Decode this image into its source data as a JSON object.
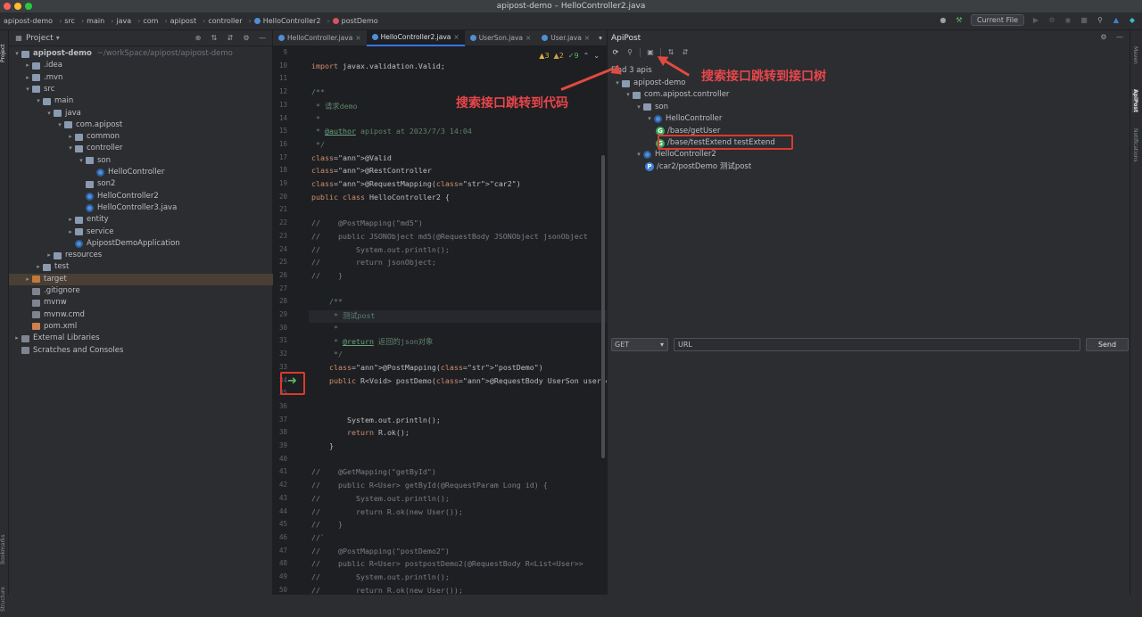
{
  "window": {
    "title": "apipost-demo – HelloController2.java"
  },
  "breadcrumbs": [
    "apipost-demo",
    "src",
    "main",
    "java",
    "com",
    "apipost",
    "controller",
    "HelloController2",
    "postDemo"
  ],
  "toolbar": {
    "run_config": "Current File"
  },
  "project_panel": {
    "title": "Project",
    "tree": [
      {
        "label": "apipost-demo",
        "extra": "~/workSpace/apipost/apipost-demo",
        "icon": "module-icon",
        "expanded": true
      },
      {
        "label": ".idea",
        "icon": "folder-icon"
      },
      {
        "label": ".mvn",
        "icon": "folder-icon"
      },
      {
        "label": "src",
        "icon": "folder-icon",
        "expanded": true
      },
      {
        "label": "main",
        "icon": "folder-icon",
        "expanded": true
      },
      {
        "label": "java",
        "icon": "folder-icon",
        "expanded": true
      },
      {
        "label": "com.apipost",
        "icon": "package-icon",
        "expanded": true
      },
      {
        "label": "common",
        "icon": "package-icon"
      },
      {
        "label": "controller",
        "icon": "package-icon",
        "expanded": true
      },
      {
        "label": "son",
        "icon": "package-icon",
        "expanded": true
      },
      {
        "label": "HelloController",
        "icon": "class-icon"
      },
      {
        "label": "son2",
        "icon": "package-icon"
      },
      {
        "label": "HelloController2",
        "icon": "class-icon"
      },
      {
        "label": "HelloController3.java",
        "icon": "java-file-icon"
      },
      {
        "label": "entity",
        "icon": "package-icon"
      },
      {
        "label": "service",
        "icon": "package-icon"
      },
      {
        "label": "ApipostDemoApplication",
        "icon": "class-icon"
      },
      {
        "label": "resources",
        "icon": "folder-icon"
      },
      {
        "label": "test",
        "icon": "folder-icon"
      },
      {
        "label": "target",
        "icon": "folder-icon",
        "selected": true
      },
      {
        "label": ".gitignore",
        "icon": "file-icon"
      },
      {
        "label": "mvnw",
        "icon": "file-icon"
      },
      {
        "label": "mvnw.cmd",
        "icon": "file-icon"
      },
      {
        "label": "pom.xml",
        "icon": "maven-icon"
      },
      {
        "label": "External Libraries",
        "icon": "library-icon"
      },
      {
        "label": "Scratches and Consoles",
        "icon": "scratch-icon"
      }
    ]
  },
  "editor": {
    "tabs": [
      {
        "label": "HelloController.java"
      },
      {
        "label": "HelloController2.java",
        "active": true
      },
      {
        "label": "UserSon.java"
      },
      {
        "label": "User.java"
      }
    ],
    "inspections": {
      "warnings": "3",
      "weak": "2",
      "typos": "9"
    },
    "lines": [
      {
        "n": "9",
        "text": ""
      },
      {
        "n": "10",
        "text": "import javax.validation.Valid;"
      },
      {
        "n": "11",
        "text": ""
      },
      {
        "n": "12",
        "text": "/**"
      },
      {
        "n": "13",
        "text": " * 请求demo"
      },
      {
        "n": "14",
        "text": " *"
      },
      {
        "n": "15",
        "text": " * @author apipost at 2023/7/3 14:04"
      },
      {
        "n": "16",
        "text": " */"
      },
      {
        "n": "17",
        "text": "@Valid"
      },
      {
        "n": "18",
        "text": "@RestController"
      },
      {
        "n": "19",
        "text": "@RequestMapping(\"car2\")"
      },
      {
        "n": "20",
        "text": "public class HelloController2 {"
      },
      {
        "n": "21",
        "text": ""
      },
      {
        "n": "22",
        "text": "//    @PostMapping(\"md5\")"
      },
      {
        "n": "23",
        "text": "//    public JSONObject md5(@RequestBody JSONObject jsonObject"
      },
      {
        "n": "24",
        "text": "//        System.out.println();"
      },
      {
        "n": "25",
        "text": "//        return jsonObject;"
      },
      {
        "n": "26",
        "text": "//    }"
      },
      {
        "n": "27",
        "text": ""
      },
      {
        "n": "28",
        "text": "    /**"
      },
      {
        "n": "29",
        "text": "     * 测试post"
      },
      {
        "n": "30",
        "text": "     *"
      },
      {
        "n": "31",
        "text": "     * @return 返回的json对象"
      },
      {
        "n": "32",
        "text": "     */"
      },
      {
        "n": "33",
        "text": "    @PostMapping(\"postDemo\")"
      },
      {
        "n": "34",
        "text": "    public R<Void> postDemo(@RequestBody UserSon userSon) {"
      },
      {
        "n": "35",
        "text": ""
      },
      {
        "n": "36",
        "text": ""
      },
      {
        "n": "37",
        "text": "        System.out.println();"
      },
      {
        "n": "38",
        "text": "        return R.ok();"
      },
      {
        "n": "39",
        "text": "    }"
      },
      {
        "n": "40",
        "text": ""
      },
      {
        "n": "41",
        "text": "//    @GetMapping(\"getById\")"
      },
      {
        "n": "42",
        "text": "//    public R<User> getById(@RequestParam Long id) {"
      },
      {
        "n": "43",
        "text": "//        System.out.println();"
      },
      {
        "n": "44",
        "text": "//        return R.ok(new User());"
      },
      {
        "n": "45",
        "text": "//    }"
      },
      {
        "n": "46",
        "text": "//`"
      },
      {
        "n": "47",
        "text": "//    @PostMapping(\"postDemo2\")"
      },
      {
        "n": "48",
        "text": "//    public R<User> postpostDemo2(@RequestBody R<List<User>>"
      },
      {
        "n": "49",
        "text": "//        System.out.println();"
      },
      {
        "n": "50",
        "text": "//        return R.ok(new User());"
      }
    ]
  },
  "apipost_panel": {
    "title": "ApiPost",
    "find_summary": "Find 3 apis",
    "tree": [
      {
        "label": "apipost-demo",
        "icon": "module-icon"
      },
      {
        "label": "com.apipost.controller",
        "icon": "package-icon"
      },
      {
        "label": "son",
        "icon": "package-icon"
      },
      {
        "label": "HelloController",
        "icon": "class-icon"
      },
      {
        "label": "/base/getUser",
        "method": "G"
      },
      {
        "label": "/base/testExtend  testExtend",
        "method": "G",
        "highlighted": true
      },
      {
        "label": "HelloController2",
        "icon": "class-icon"
      },
      {
        "label": "/car2/postDemo  测试post",
        "method": "P"
      }
    ],
    "request": {
      "method": "GET",
      "url_placeholder": "URL",
      "send_label": "Send"
    }
  },
  "annotations": {
    "jump_to_code": "搜索接口跳转到代码",
    "jump_to_tree": "搜索接口跳转到接口树"
  },
  "right_toolwindows": [
    "Maven",
    "ApiPost",
    "Notifications"
  ],
  "left_toolwindows": [
    "Project",
    "Bookmarks",
    "Structure"
  ]
}
